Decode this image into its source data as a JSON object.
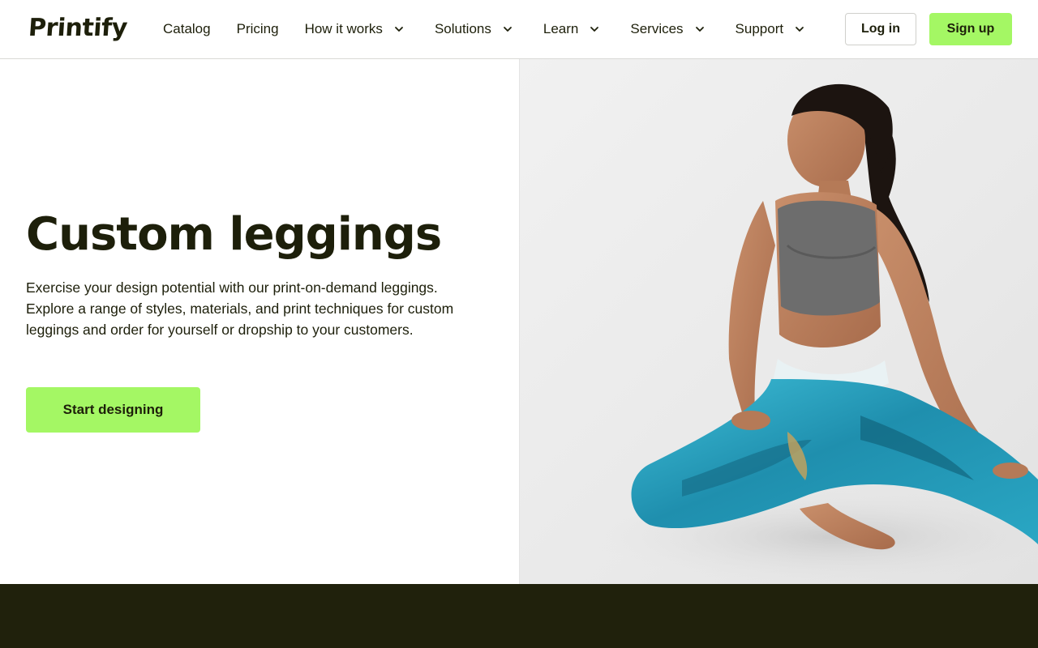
{
  "brand": {
    "name": "Printify"
  },
  "nav": {
    "items": [
      {
        "label": "Catalog",
        "dropdown": false
      },
      {
        "label": "Pricing",
        "dropdown": false
      },
      {
        "label": "How it works",
        "dropdown": true
      },
      {
        "label": "Solutions",
        "dropdown": true
      },
      {
        "label": "Learn",
        "dropdown": true
      },
      {
        "label": "Services",
        "dropdown": true
      },
      {
        "label": "Support",
        "dropdown": true
      }
    ]
  },
  "auth": {
    "login_label": "Log in",
    "signup_label": "Sign up"
  },
  "hero": {
    "title": "Custom leggings",
    "description": "Exercise your design potential with our print-on-demand leggings. Explore a range of styles, materials, and print techniques for custom leggings and order for yourself or dropship to your customers.",
    "cta_label": "Start designing",
    "image_alt": "Woman in gray sports bra and blue marbled leggings sitting on the floor"
  },
  "colors": {
    "accent": "#a4f764",
    "text": "#1d1f0a",
    "footer_band": "#20210c",
    "leggings": "#2aa7c4"
  }
}
